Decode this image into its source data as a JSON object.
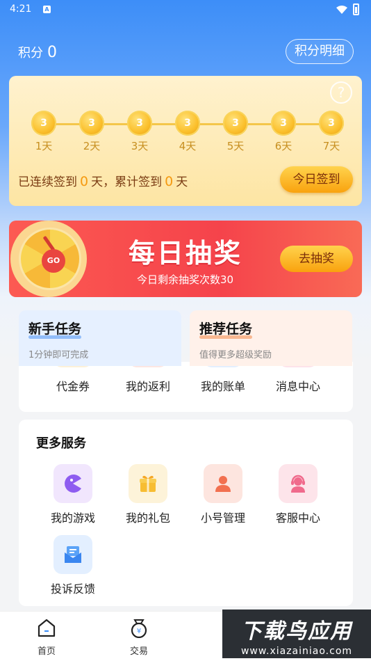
{
  "status_bar": {
    "time": "4:21"
  },
  "header": {
    "points_label": "积分",
    "points_value": "0",
    "detail_button": "积分明细"
  },
  "signin": {
    "coin_value": "3",
    "days": [
      "1天",
      "2天",
      "3天",
      "4天",
      "5天",
      "6天",
      "7天"
    ],
    "streak_prefix": "已连续签到",
    "streak_days": "0",
    "streak_unit1": "天，",
    "total_prefix": "累计签到",
    "total_days": "0",
    "total_unit": "天",
    "button": "今日签到",
    "help_glyph": "?"
  },
  "lottery": {
    "wheel_center": "GO",
    "title": "每日抽奖",
    "subtitle": "今日剩余抽奖次数30",
    "button": "去抽奖"
  },
  "tasks": {
    "newbie": {
      "title": "新手任务",
      "subtitle": "1分钟即可完成"
    },
    "recommend": {
      "title": "推荐任务",
      "subtitle": "值得更多超级奖励"
    }
  },
  "wallet_items": [
    {
      "label": "代金券",
      "icon": "voucher-icon",
      "color": "#fdf1d8"
    },
    {
      "label": "我的返利",
      "icon": "rebate-icon",
      "color": "#fde6e1"
    },
    {
      "label": "我的账单",
      "icon": "bill-icon",
      "color": "#e2efff"
    },
    {
      "label": "消息中心",
      "icon": "message-icon",
      "color": "#fde3ea"
    }
  ],
  "more_services": {
    "title": "更多服务",
    "items": [
      {
        "label": "我的游戏",
        "icon": "game-icon",
        "color": "#f1e6fd"
      },
      {
        "label": "我的礼包",
        "icon": "gift-icon",
        "color": "#fdf3d9"
      },
      {
        "label": "小号管理",
        "icon": "account-icon",
        "color": "#fde5df"
      },
      {
        "label": "客服中心",
        "icon": "support-icon",
        "color": "#fde4ea"
      },
      {
        "label": "投诉反馈",
        "icon": "feedback-icon",
        "color": "#e3efff"
      }
    ]
  },
  "tabbar": [
    {
      "label": "首页",
      "icon": "home-icon"
    },
    {
      "label": "交易",
      "icon": "trade-bag-icon"
    }
  ],
  "watermark": {
    "title": "下载鸟应用",
    "url": "www.xiazainiao.com"
  }
}
